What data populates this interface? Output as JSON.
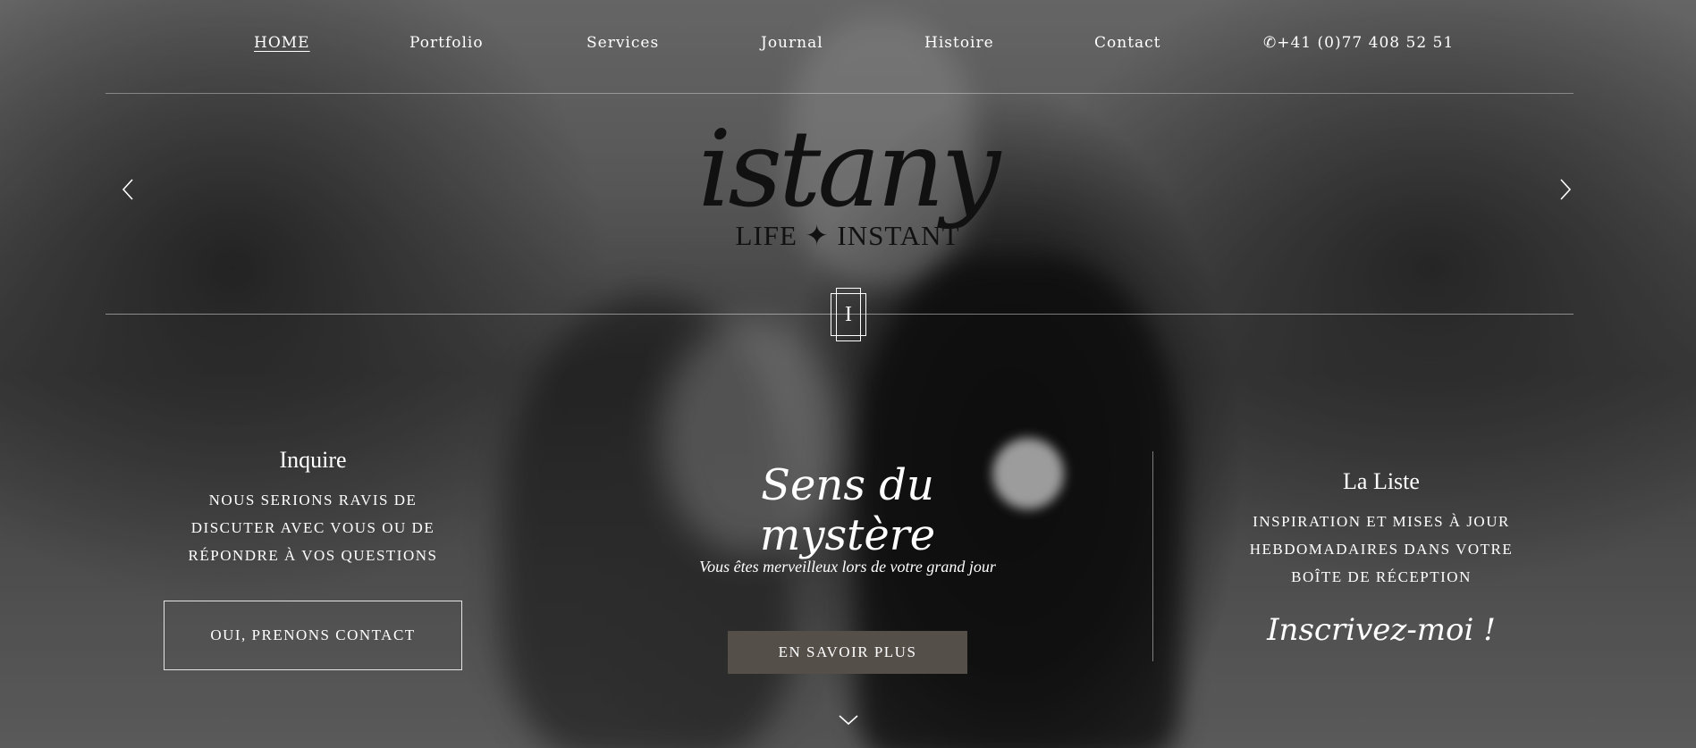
{
  "nav": {
    "items": [
      {
        "label": "HOME",
        "active": true
      },
      {
        "label": "Portfolio"
      },
      {
        "label": "Services"
      },
      {
        "label": "Journal"
      },
      {
        "label": "Histoire"
      },
      {
        "label": "Contact"
      }
    ],
    "phone": "+41 (0)77 408 52 51"
  },
  "logo": {
    "script": "istany",
    "tagline": "LIFE ✦ INSTANT"
  },
  "monogram": "I",
  "left": {
    "title": "Inquire",
    "text": "NOUS SERIONS RAVIS DE DISCUTER AVEC VOUS OU DE RÉPONDRE À VOS QUESTIONS",
    "button": "OUI, PRENONS CONTACT"
  },
  "center": {
    "title": "Sens du mystère",
    "subtitle": "Vous êtes merveilleux lors de votre grand jour",
    "button": "EN SAVOIR PLUS"
  },
  "right": {
    "title": "La Liste",
    "text": "INSPIRATION ET MISES À JOUR HEBDOMADAIRES DANS VOTRE BOÎTE DE RÉCEPTION",
    "link": "Inscrivez-moi !"
  },
  "icons": {
    "prev": "chevron-left-icon",
    "next": "chevron-right-icon",
    "phone": "phone-icon",
    "scroll": "chevron-down-icon"
  },
  "colors": {
    "button_bg": "#554f4a",
    "text": "#ffffff",
    "logo": "#111111"
  }
}
